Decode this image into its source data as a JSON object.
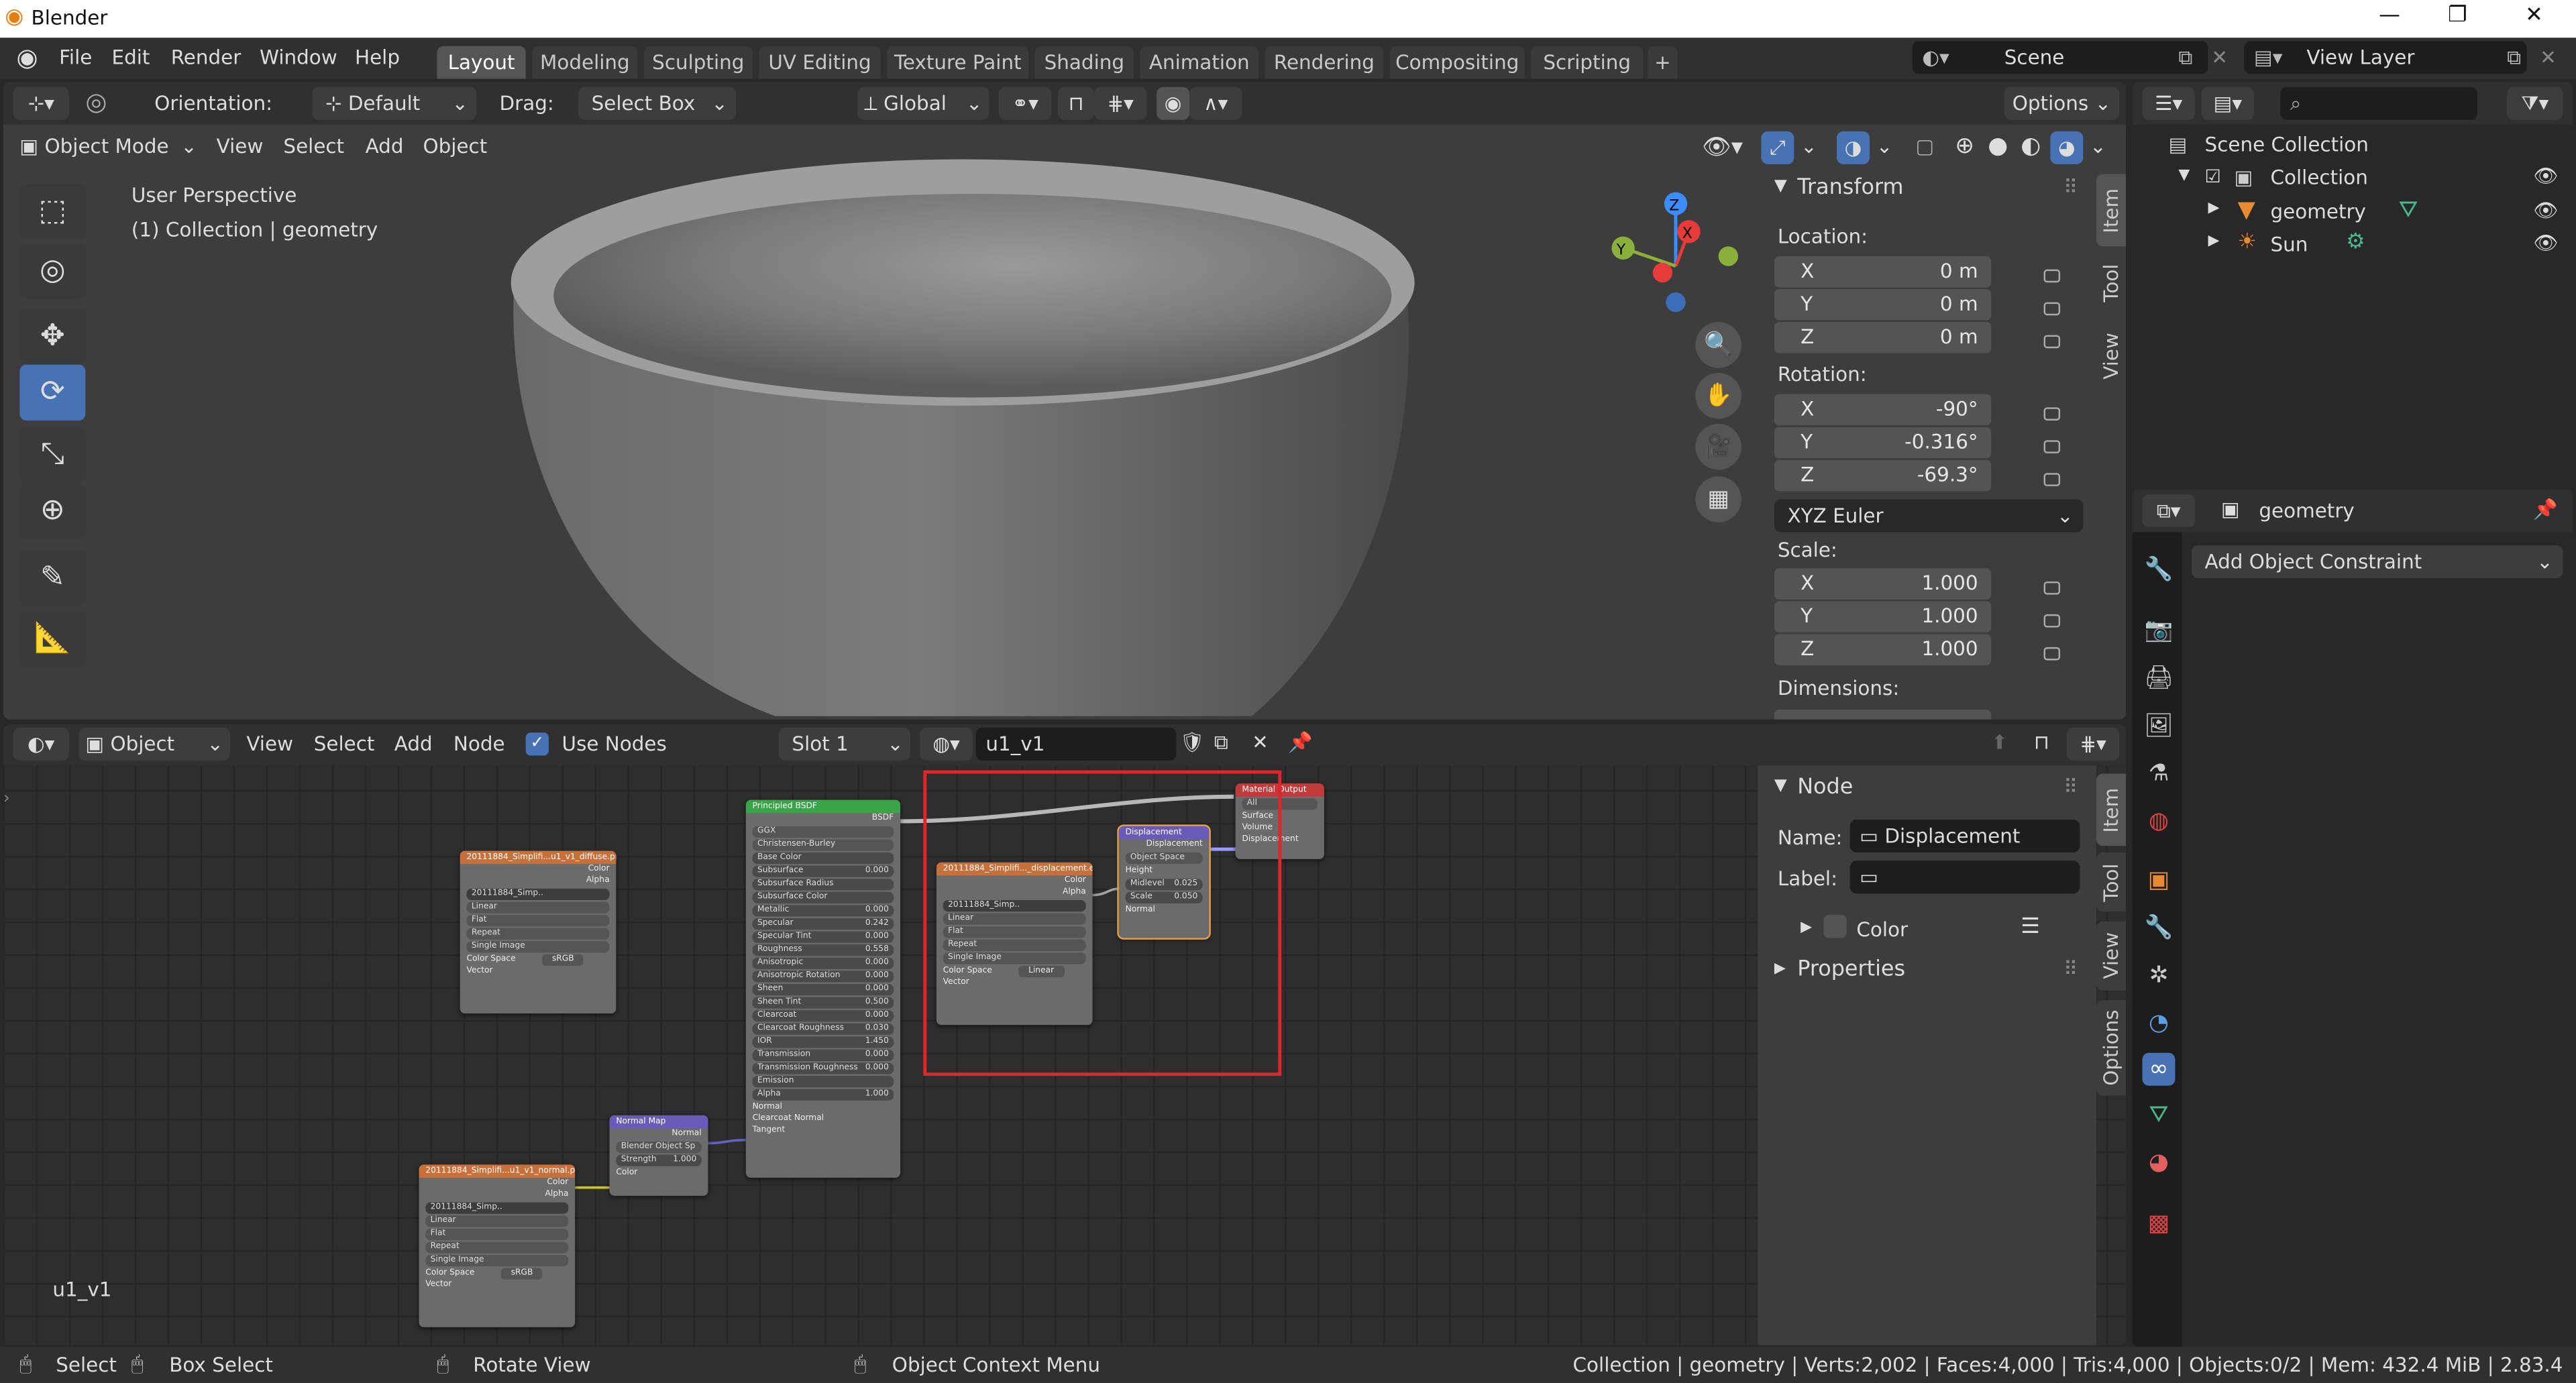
{
  "app": {
    "title": "Blender"
  },
  "window_controls": [
    "—",
    "❐",
    "✕"
  ],
  "menu": [
    "File",
    "Edit",
    "Render",
    "Window",
    "Help"
  ],
  "workspace_tabs": [
    "Layout",
    "Modeling",
    "Sculpting",
    "UV Editing",
    "Texture Paint",
    "Shading",
    "Animation",
    "Rendering",
    "Compositing",
    "Scripting"
  ],
  "active_tab": "Layout",
  "add_tab": "+",
  "scene": {
    "name": "Scene",
    "view_layer": "View Layer"
  },
  "toolbar": {
    "orientation_label": "Orientation:",
    "orientation_value": "Default",
    "drag_label": "Drag:",
    "drag_value": "Select Box",
    "transform_orientation": "Global",
    "options": "Options"
  },
  "viewport": {
    "mode": "Object Mode",
    "menus": [
      "View",
      "Select",
      "Add",
      "Object"
    ],
    "overlay_line1": "User Perspective",
    "overlay_line2": "(1) Collection | geometry",
    "gizmo_axes": {
      "z": "Z",
      "x": "X",
      "y": "Y"
    }
  },
  "transform_panel": {
    "title": "Transform",
    "location_label": "Location:",
    "location": [
      {
        "axis": "X",
        "value": "0 m"
      },
      {
        "axis": "Y",
        "value": "0 m"
      },
      {
        "axis": "Z",
        "value": "0 m"
      }
    ],
    "rotation_label": "Rotation:",
    "rotation": [
      {
        "axis": "X",
        "value": "-90°"
      },
      {
        "axis": "Y",
        "value": "-0.316°"
      },
      {
        "axis": "Z",
        "value": "-69.3°"
      }
    ],
    "rotation_mode": "XYZ Euler",
    "scale_label": "Scale:",
    "scale": [
      {
        "axis": "X",
        "value": "1.000"
      },
      {
        "axis": "Y",
        "value": "1.000"
      },
      {
        "axis": "Z",
        "value": "1.000"
      }
    ],
    "dimensions_label": "Dimensions:"
  },
  "viewport_side_tabs": [
    "Item",
    "Tool",
    "View"
  ],
  "outliner": {
    "scene_collection": "Scene Collection",
    "items": [
      {
        "name": "Collection"
      },
      {
        "name": "geometry"
      },
      {
        "name": "Sun"
      }
    ]
  },
  "properties": {
    "object_name": "geometry",
    "add_constraint": "Add Object Constraint"
  },
  "node_editor": {
    "type": "Object",
    "menus": [
      "View",
      "Select",
      "Add",
      "Node"
    ],
    "use_nodes_label": "Use Nodes",
    "slot": "Slot 1",
    "material": "u1_v1",
    "corner_label": "u1_v1",
    "side_tabs": [
      "Item",
      "Tool",
      "View",
      "Options"
    ]
  },
  "node_panel": {
    "title": "Node",
    "name_label": "Name:",
    "name_value": "Displacement",
    "label_label": "Label:",
    "label_value": "",
    "color_label": "Color",
    "properties_label": "Properties"
  },
  "nodes": {
    "principled": {
      "title": "Principled BSDF",
      "out": "BSDF",
      "dist": "GGX",
      "sss": "Christensen-Burley",
      "rows": [
        {
          "label": "Base Color",
          "value": ""
        },
        {
          "label": "Subsurface",
          "value": "0.000"
        },
        {
          "label": "Subsurface Radius",
          "value": ""
        },
        {
          "label": "Subsurface Color",
          "value": ""
        },
        {
          "label": "Metallic",
          "value": "0.000"
        },
        {
          "label": "Specular",
          "value": "0.242"
        },
        {
          "label": "Specular Tint",
          "value": "0.000"
        },
        {
          "label": "Roughness",
          "value": "0.558"
        },
        {
          "label": "Anisotropic",
          "value": "0.000"
        },
        {
          "label": "Anisotropic Rotation",
          "value": "0.000"
        },
        {
          "label": "Sheen",
          "value": "0.000"
        },
        {
          "label": "Sheen Tint",
          "value": "0.500"
        },
        {
          "label": "Clearcoat",
          "value": "0.000"
        },
        {
          "label": "Clearcoat Roughness",
          "value": "0.030"
        },
        {
          "label": "IOR",
          "value": "1.450"
        },
        {
          "label": "Transmission",
          "value": "0.000"
        },
        {
          "label": "Transmission Roughness",
          "value": "0.000"
        },
        {
          "label": "Emission",
          "value": ""
        },
        {
          "label": "Alpha",
          "value": "1.000"
        }
      ],
      "inputs": [
        "Normal",
        "Clearcoat Normal",
        "Tangent"
      ]
    },
    "diffuse_tex": {
      "title": "20111884_Simplifi...u1_v1_diffuse.png",
      "image": "20111884_Simp..",
      "color_space": "sRGB"
    },
    "disp_tex": {
      "title": "20111884_Simplifi..._displacement.exr",
      "image": "20111884_Simp..",
      "color_space": "Linear"
    },
    "normal_tex": {
      "title": "20111884_Simplifi...u1_v1_normal.png",
      "image": "20111884_Simp..",
      "color_space": "sRGB"
    },
    "tex_common": {
      "out_color": "Color",
      "out_alpha": "Alpha",
      "interp": "Linear",
      "proj": "Flat",
      "ext": "Repeat",
      "src": "Single Image",
      "cs_label": "Color Space",
      "vector": "Vector"
    },
    "normal_map": {
      "title": "Normal Map",
      "out": "Normal",
      "space": "Blender Object Sp",
      "strength_label": "Strength",
      "strength": "1.000",
      "color": "Color"
    },
    "displacement": {
      "title": "Displacement",
      "out": "Displacement",
      "space": "Object Space",
      "height": "Height",
      "midlevel_label": "Midlevel",
      "midlevel": "0.025",
      "scale_label": "Scale",
      "scale": "0.050",
      "normal": "Normal"
    },
    "material_output": {
      "title": "Material Output",
      "target": "All",
      "inputs": [
        "Surface",
        "Volume",
        "Displacement"
      ]
    }
  },
  "statusbar": {
    "select": "Select",
    "box_select": "Box Select",
    "rotate_view": "Rotate View",
    "context_menu": "Object Context Menu",
    "stats": "Collection | geometry | Verts:2,002 | Faces:4,000 | Tris:4,000 | Objects:0/2 | Mem: 432.4 MiB | 2.83.4"
  },
  "colors": {
    "accent": "#4772b3",
    "highlight_box": "#e0262c",
    "node_shader_header": "#3aa548",
    "node_texture_header": "#c8703a",
    "node_vector_header": "#6b5bb8",
    "node_output_header": "#c23b3b"
  }
}
